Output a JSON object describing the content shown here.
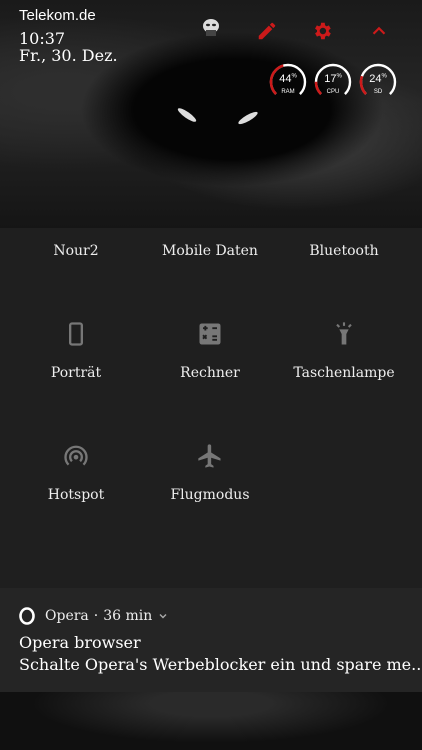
{
  "status": {
    "carrier": "Telekom.de",
    "time": "10:37",
    "date": "Fr., 30. Dez."
  },
  "icons": {
    "edit": "pencil-icon",
    "settings": "gear-icon",
    "collapse": "chevron-up-icon",
    "avatar": "mask-icon"
  },
  "gauges": [
    {
      "value": "44",
      "unit": "%",
      "label": "RAM",
      "percent": 44
    },
    {
      "value": "17",
      "unit": "%",
      "label": "CPU",
      "percent": 17
    },
    {
      "value": "24",
      "unit": "%",
      "label": "SD",
      "percent": 24
    }
  ],
  "quick_settings": {
    "row1": [
      "Nour2",
      "Mobile Daten",
      "Bluetooth"
    ],
    "tiles": [
      {
        "label": "Porträt",
        "icon": "phone-portrait-icon"
      },
      {
        "label": "Rechner",
        "icon": "calculator-icon"
      },
      {
        "label": "Taschenlampe",
        "icon": "flashlight-icon"
      },
      {
        "label": "Hotspot",
        "icon": "hotspot-icon"
      },
      {
        "label": "Flugmodus",
        "icon": "airplane-icon"
      }
    ]
  },
  "notification": {
    "app": "Opera",
    "age": "36 min",
    "separator": "·",
    "title": "Opera browser",
    "body": "Schalte Opera's Werbeblocker ein und spare me.."
  },
  "colors": {
    "accent": "#cc1a1a",
    "panel": "#1f1f1f",
    "notification": "#252525"
  }
}
